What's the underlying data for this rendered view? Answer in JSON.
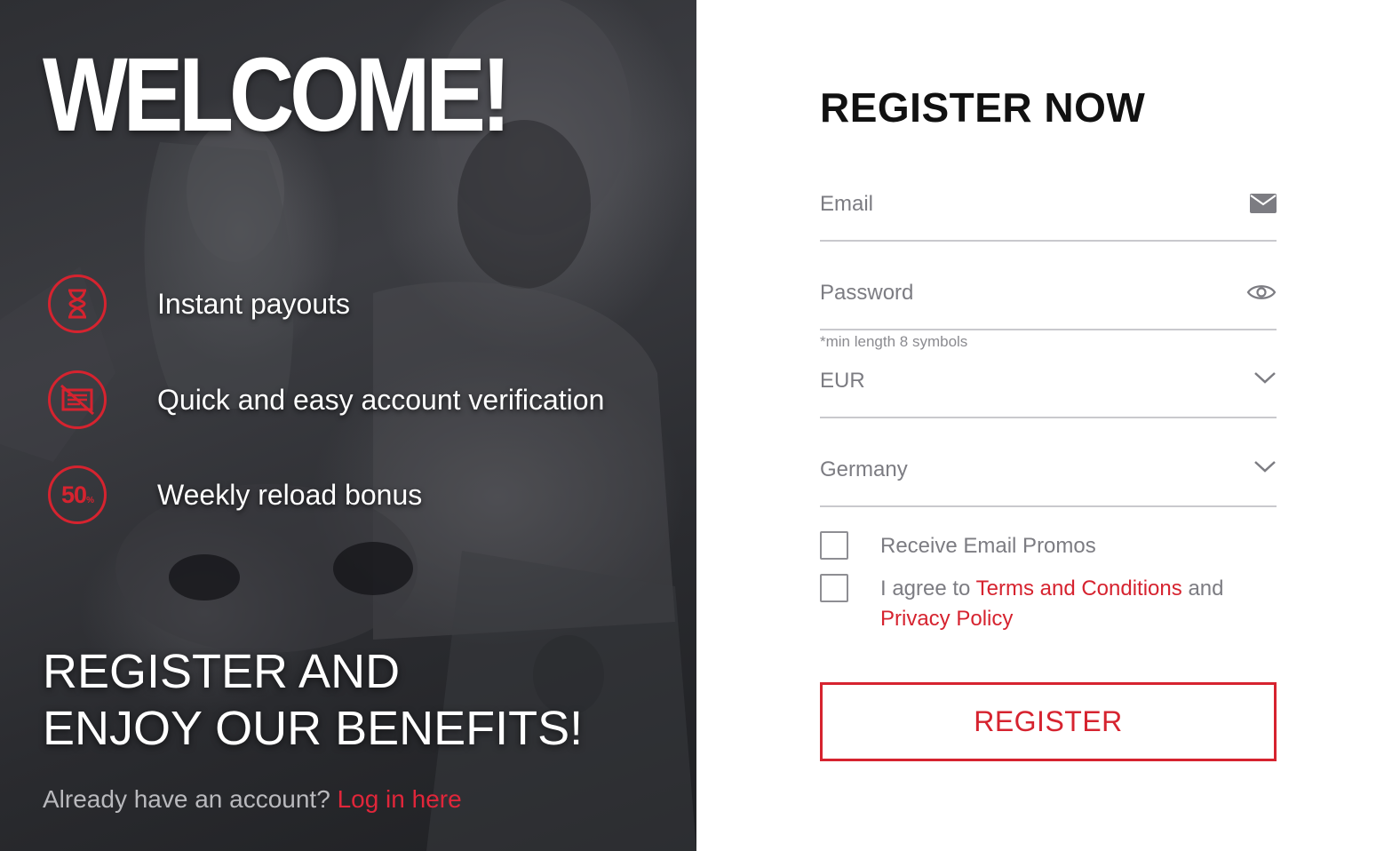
{
  "left": {
    "welcome": "WELCOME!",
    "benefits": [
      {
        "label": "Instant payouts",
        "icon": "hourglass-icon"
      },
      {
        "label": "Quick and easy account verification",
        "icon": "no-documents-icon"
      },
      {
        "label": "Weekly reload bonus",
        "icon": "fifty-percent-icon"
      }
    ],
    "fifty_text": "50",
    "percent_text": "%",
    "headline": "REGISTER AND\nENJOY OUR BENEFITS!",
    "already_text": "Already have an account?",
    "login_link": "Log in here"
  },
  "form": {
    "title": "REGISTER NOW",
    "email_placeholder": "Email",
    "email_icon": "envelope-icon",
    "password_placeholder": "Password",
    "password_icon": "eye-icon",
    "password_hint": "*min length 8 symbols",
    "currency_value": "EUR",
    "country_value": "Germany",
    "promos_label": "Receive Email Promos",
    "agree_prefix": "I agree to",
    "terms_link": "Terms and Conditions",
    "agree_and": "and",
    "privacy_link": "Privacy Policy",
    "register_button": "REGISTER"
  },
  "colors": {
    "accent": "#d6232f",
    "left_bg": "#2e2f33",
    "label_gray": "#7c7c82"
  }
}
